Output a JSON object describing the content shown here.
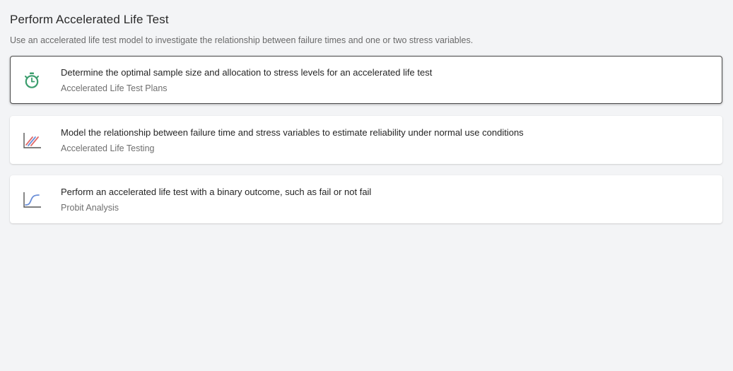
{
  "page": {
    "title": "Perform Accelerated Life Test",
    "subtitle": "Use an accelerated life test model to investigate the relationship between failure times and one or two stress variables."
  },
  "options": [
    {
      "title": "Determine the optimal sample size and allocation to stress levels for an accelerated life test",
      "subtitle": "Accelerated Life Test Plans",
      "icon": "stopwatch-icon",
      "selected": true
    },
    {
      "title": "Model the relationship between failure time and stress variables to estimate reliability under normal use conditions",
      "subtitle": "Accelerated Life Testing",
      "icon": "stress-lines-chart-icon",
      "selected": false
    },
    {
      "title": "Perform an accelerated life test with a binary outcome, such as fail or not fail",
      "subtitle": "Probit Analysis",
      "icon": "s-curve-chart-icon",
      "selected": false
    }
  ],
  "colors": {
    "background": "#f3f4f6",
    "card": "#ffffff",
    "stopwatch_green": "#3c9e6e",
    "axis_gray": "#555555",
    "line_red": "#e06b6b",
    "line_blue": "#6b8fd8"
  }
}
